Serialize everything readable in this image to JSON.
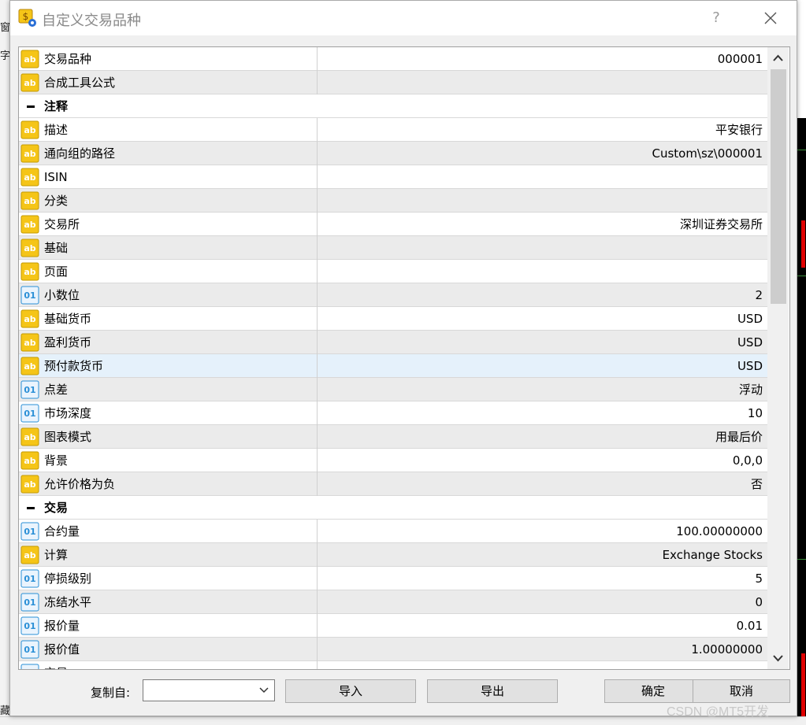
{
  "window": {
    "title": "自定义交易品种",
    "help_label": "?"
  },
  "background": {
    "left_fragments": [
      "窗",
      "字",
      "藏"
    ]
  },
  "properties": [
    {
      "type": "row",
      "icon": "ab",
      "name": "交易品种",
      "value": "000001"
    },
    {
      "type": "row",
      "icon": "ab",
      "name": "合成工具公式",
      "value": ""
    },
    {
      "type": "section",
      "name": "注释"
    },
    {
      "type": "row",
      "icon": "ab",
      "name": "描述",
      "value": "平安银行"
    },
    {
      "type": "row",
      "icon": "ab",
      "name": "通向组的路径",
      "value": "Custom\\sz\\000001"
    },
    {
      "type": "row",
      "icon": "ab",
      "name": "ISIN",
      "value": ""
    },
    {
      "type": "row",
      "icon": "ab",
      "name": "分类",
      "value": ""
    },
    {
      "type": "row",
      "icon": "ab",
      "name": "交易所",
      "value": "深圳证券交易所"
    },
    {
      "type": "row",
      "icon": "ab",
      "name": "基础",
      "value": ""
    },
    {
      "type": "row",
      "icon": "ab",
      "name": "页面",
      "value": ""
    },
    {
      "type": "row",
      "icon": "01",
      "name": "小数位",
      "value": "2"
    },
    {
      "type": "row",
      "icon": "ab",
      "name": "基础货币",
      "value": "USD"
    },
    {
      "type": "row",
      "icon": "ab",
      "name": "盈利货币",
      "value": "USD"
    },
    {
      "type": "row",
      "icon": "ab",
      "name": "预付款货币",
      "value": "USD",
      "selected": true
    },
    {
      "type": "row",
      "icon": "01",
      "name": "点差",
      "value": "浮动"
    },
    {
      "type": "row",
      "icon": "01",
      "name": "市场深度",
      "value": "10"
    },
    {
      "type": "row",
      "icon": "ab",
      "name": "图表模式",
      "value": "用最后价"
    },
    {
      "type": "row",
      "icon": "ab",
      "name": "背景",
      "value": "0,0,0"
    },
    {
      "type": "row",
      "icon": "ab",
      "name": "允许价格为负",
      "value": "否"
    },
    {
      "type": "section",
      "name": "交易"
    },
    {
      "type": "row",
      "icon": "01",
      "name": "合约量",
      "value": "100.00000000"
    },
    {
      "type": "row",
      "icon": "ab",
      "name": "计算",
      "value": "Exchange Stocks"
    },
    {
      "type": "row",
      "icon": "01",
      "name": "停损级别",
      "value": "5"
    },
    {
      "type": "row",
      "icon": "01",
      "name": "冻结水平",
      "value": "0"
    },
    {
      "type": "row",
      "icon": "01",
      "name": "报价量",
      "value": "0.01"
    },
    {
      "type": "row",
      "icon": "01",
      "name": "报价值",
      "value": "1.00000000"
    },
    {
      "type": "row",
      "icon": "01",
      "name": "交易",
      "value": ""
    }
  ],
  "bottom": {
    "copy_from_label": "复制自:",
    "copy_from_value": "",
    "import_label": "导入",
    "export_label": "导出",
    "ok_label": "确定",
    "cancel_label": "取消"
  },
  "watermark": "CSDN @MT5开发",
  "colors": {
    "ab_icon": "#f5c518",
    "num_icon": "#2a8fd6",
    "selected_row": "#e5f1fb"
  }
}
